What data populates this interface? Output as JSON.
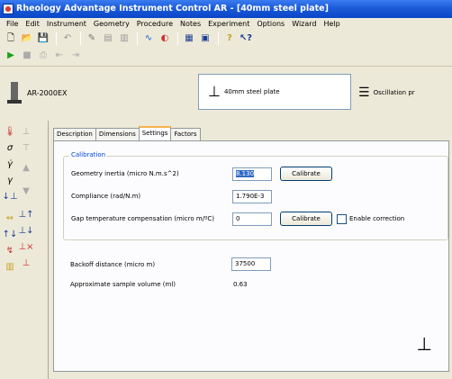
{
  "window": {
    "title": "Rheology Advantage Instrument Control AR - [40mm steel plate]"
  },
  "menu": [
    "File",
    "Edit",
    "Instrument",
    "Geometry",
    "Procedure",
    "Notes",
    "Experiment",
    "Options",
    "Wizard",
    "Help"
  ],
  "instrument": {
    "name": "AR-2000EX"
  },
  "geometry": {
    "name": "40mm steel plate"
  },
  "procedure": {
    "name": "Oscillation pr"
  },
  "tabs": [
    "Description",
    "Dimensions",
    "Settings",
    "Factors"
  ],
  "settings": {
    "group_label": "Calibration",
    "inertia_label": "Geometry inertia (micro N.m.s^2)",
    "inertia_value": "8.130",
    "compliance_label": "Compliance (rad/N.m)",
    "compliance_value": "1.790E-3",
    "gap_label": "Gap temperature compensation (micro m/ºC)",
    "gap_value": "0",
    "calibrate_label": "Calibrate",
    "enable_label": "Enable correction",
    "backoff_label": "Backoff distance (micro m)",
    "backoff_value": "37500",
    "volume_label": "Approximate sample volume (ml)",
    "volume_value": "0.63"
  }
}
